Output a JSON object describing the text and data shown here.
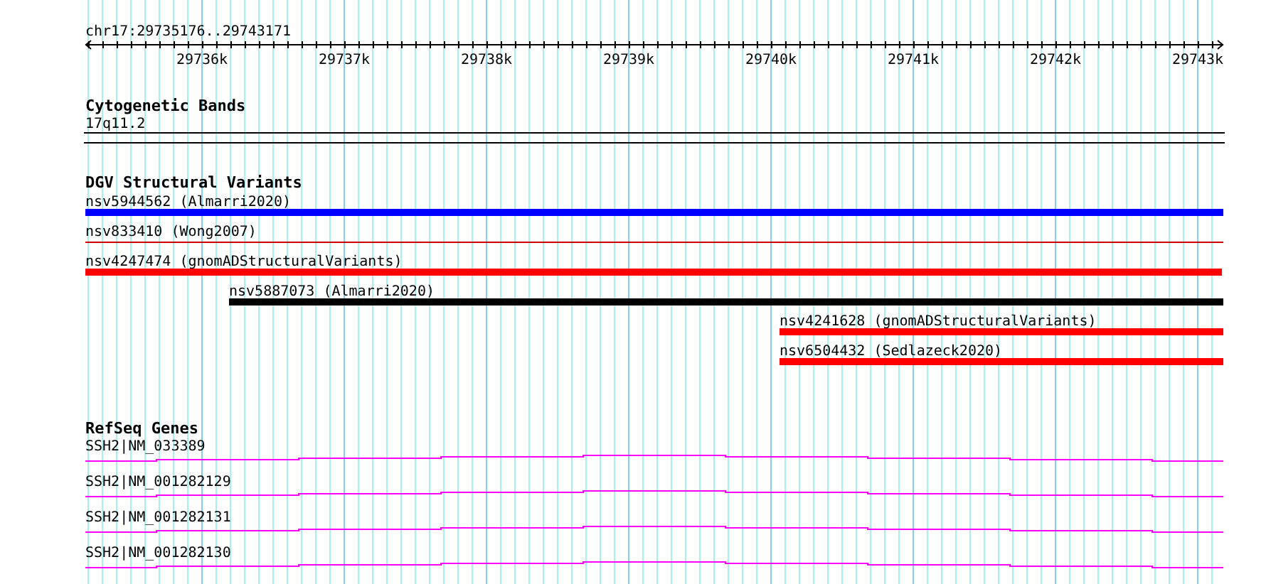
{
  "location": "chr17:29735176..29743171",
  "ruler": {
    "ticks": [
      "29736k",
      "29737k",
      "29738k",
      "29739k",
      "29740k",
      "29741k",
      "29742k",
      "29743k"
    ]
  },
  "tracks": [
    {
      "kind": "cytoband",
      "title": "Cytogenetic Bands",
      "features": [
        {
          "label": "17q11.2"
        }
      ]
    },
    {
      "kind": "variants",
      "title": "DGV Structural Variants",
      "features": [
        {
          "label": "nsv5944562 (Almarri2020)",
          "color": "#0000ff",
          "kind": "bar"
        },
        {
          "label": "nsv833410 (Wong2007)",
          "color": "#cc0000",
          "kind": "line"
        },
        {
          "label": "nsv4247474 (gnomADStructuralVariants)",
          "color": "#ff0000",
          "kind": "bar"
        },
        {
          "label": "nsv5887073 (Almarri2020)",
          "color": "#000000",
          "kind": "bar"
        },
        {
          "label": "nsv4241628 (gnomADStructuralVariants)",
          "color": "#ff0000",
          "kind": "bar"
        },
        {
          "label": "nsv6504432 (Sedlazeck2020)",
          "color": "#ff0000",
          "kind": "bar"
        }
      ]
    },
    {
      "kind": "genes",
      "title": "RefSeq Genes",
      "features": [
        {
          "label": "SSH2|NM_033389"
        },
        {
          "label": "SSH2|NM_001282129"
        },
        {
          "label": "SSH2|NM_001282131"
        },
        {
          "label": "SSH2|NM_001282130"
        }
      ]
    }
  ]
}
